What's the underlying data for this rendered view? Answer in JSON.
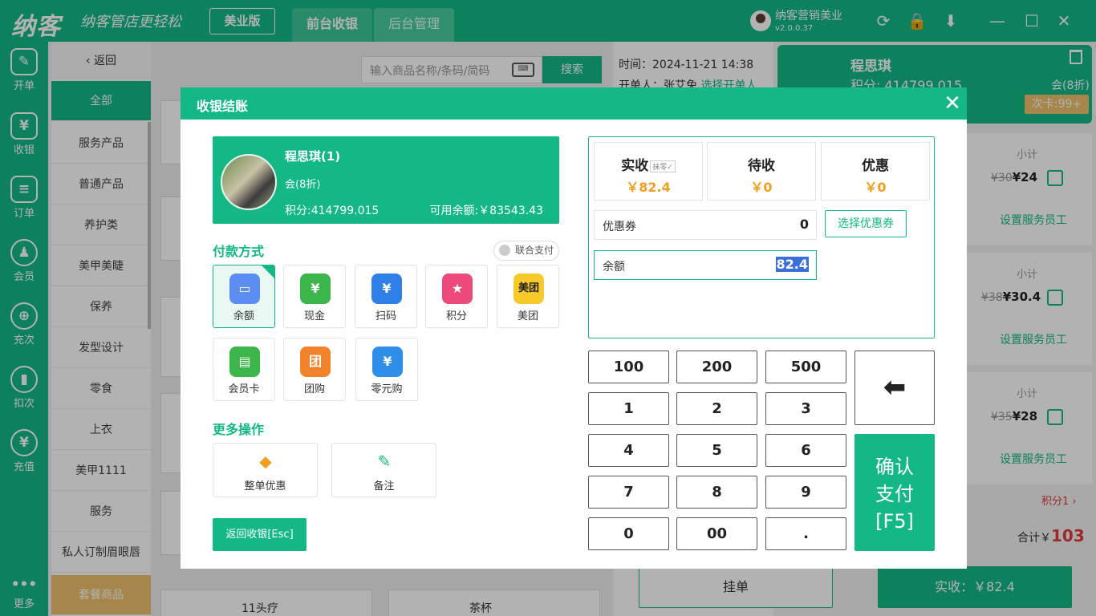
{
  "app": {
    "logo": "纳客",
    "slogan": "纳客管店更轻松",
    "edition": "美业版",
    "tabs": [
      "前台收银",
      "后台管理"
    ],
    "user_name": "纳客营销美业",
    "version": "v2.0.0.37"
  },
  "nav": [
    {
      "label": "开单",
      "icon": "billing-icon"
    },
    {
      "label": "收银",
      "icon": "cashier-icon"
    },
    {
      "label": "订单",
      "icon": "order-icon"
    },
    {
      "label": "会员",
      "icon": "member-icon"
    },
    {
      "label": "充次",
      "icon": "recharge-times-icon"
    },
    {
      "label": "扣次",
      "icon": "deduct-times-icon"
    },
    {
      "label": "充值",
      "icon": "top-up-icon"
    },
    {
      "label": "更多",
      "icon": "more-icon"
    }
  ],
  "categories": {
    "back": "返回",
    "items": [
      "全部",
      "服务产品",
      "普通产品",
      "养护类",
      "美甲美睫",
      "保养",
      "发型设计",
      "零食",
      "上衣",
      "美甲1111",
      "服务",
      "私人订制眉眼唇",
      "套餐商品"
    ]
  },
  "search": {
    "placeholder": "输入商品名称/条码/简码",
    "button": "搜索"
  },
  "products": {
    "visible": [
      "11头疗",
      "茶杯"
    ]
  },
  "order": {
    "time": "时间：2024-11-21 14:38",
    "operator_label": "开单人：张艾免",
    "operator_link": "选择开单人"
  },
  "member_panel": {
    "name": "程思琪",
    "points": "积分: 414799.015",
    "discount": "会(8折)",
    "card": "次卡:99+"
  },
  "line_items": [
    {
      "subtotal_label": "小计",
      "orig": "¥30",
      "price": "¥24",
      "staff": "设置服务员工"
    },
    {
      "subtotal_label": "小计",
      "orig": "¥38",
      "price": "¥30.4",
      "staff": "设置服务员工"
    },
    {
      "subtotal_label": "小计",
      "orig": "¥35",
      "price": "¥28",
      "staff": "设置服务员工"
    }
  ],
  "summary": {
    "points": "积分1",
    "total_label": "合计￥",
    "total": "103",
    "hang": "挂单",
    "pay": "实收：￥82.4"
  },
  "modal": {
    "title": "收银结账",
    "member": {
      "name": "程思琪(1)",
      "level": "会(8折)",
      "points": "积分:414799.015",
      "balance": "可用余额:￥83543.43"
    },
    "pay_section": "付款方式",
    "combo_pay": "联合支付",
    "pay_options": [
      {
        "label": "余额",
        "icon": "balance-icon",
        "selected": true
      },
      {
        "label": "现金",
        "icon": "cash-icon"
      },
      {
        "label": "扫码",
        "icon": "scan-icon"
      },
      {
        "label": "积分",
        "icon": "points-icon"
      },
      {
        "label": "美团",
        "icon": "meituan-icon"
      },
      {
        "label": "会员卡",
        "icon": "member-card-icon"
      },
      {
        "label": "团购",
        "icon": "group-buy-icon"
      },
      {
        "label": "零元购",
        "icon": "zero-purchase-icon"
      }
    ],
    "more_section": "更多操作",
    "more_ops": [
      {
        "label": "整单优惠",
        "icon": "discount-tag-icon"
      },
      {
        "label": "备注",
        "icon": "note-icon"
      }
    ],
    "esc_button": "返回收银[Esc]",
    "received_label": "实收",
    "erase_badge": "抹零",
    "received_value": "￥82.4",
    "pending_label": "待收",
    "pending_value": "￥0",
    "discount_label": "优惠",
    "discount_value": "￥0",
    "coupon_label": "优惠券",
    "coupon_value": "0",
    "coupon_button": "选择优惠券",
    "balance_label": "余额",
    "balance_value": "82.4",
    "keys": [
      "100",
      "200",
      "500",
      "1",
      "2",
      "3",
      "4",
      "5",
      "6",
      "7",
      "8",
      "9",
      "0",
      "00",
      "."
    ],
    "confirm_line1": "确认",
    "confirm_line2": "支付",
    "confirm_line3": "[F5]"
  },
  "colors": {
    "brand": "#13b884",
    "accent_orange": "#f0a020",
    "price_red": "#e03a3a",
    "package_gold": "#eec06a"
  }
}
